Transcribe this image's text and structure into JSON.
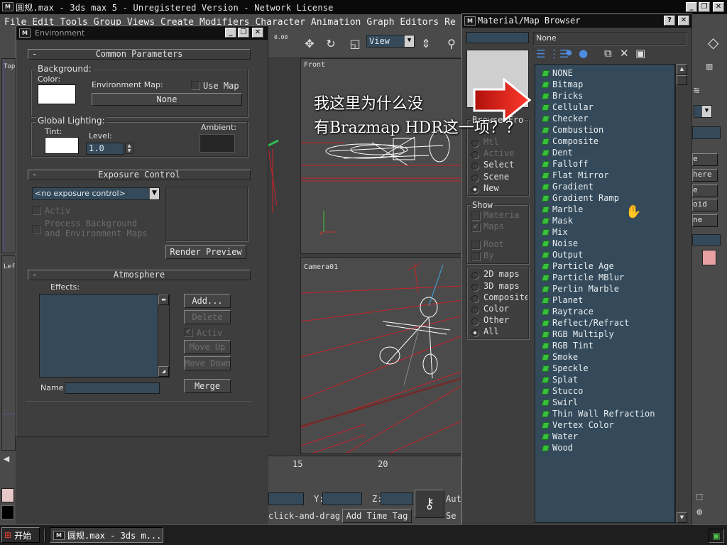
{
  "window": {
    "title": "圆规.max - 3ds max 5 - Unregistered Version - Network License",
    "app_icon": "3ds-max-icon",
    "controls": [
      "minimize",
      "restore",
      "close"
    ]
  },
  "menu": [
    "File",
    "Edit",
    "Tools",
    "Group",
    "Views",
    "Create",
    "Modifiers",
    "Character",
    "Animation",
    "Graph Editors",
    "Re"
  ],
  "toolbar": {
    "view_label": "View",
    "counter": "0.00"
  },
  "viewports": {
    "top_label": "Top",
    "left_label": "Left",
    "front_label": "Front",
    "camera_label": "Camera01"
  },
  "timeline": {
    "ticks": [
      "15",
      "20"
    ],
    "coord_y_label": "Y:",
    "coord_z_label": "Z:",
    "prompt": "click-and-drag",
    "add_time_tag": "Add Time Tag",
    "auto_label": "Aut",
    "set_label": "Se"
  },
  "environment": {
    "title": "Environment",
    "common_params": {
      "header": "Common Parameters",
      "background_group": "Background:",
      "color_label": "Color:",
      "color_value": "#ffffff",
      "env_map_label": "Environment Map:",
      "use_map_label": "Use Map",
      "use_map_checked": false,
      "env_map_button": "None",
      "global_lighting_group": "Global Lighting:",
      "tint_label": "Tint:",
      "tint_value": "#ffffff",
      "level_label": "Level:",
      "level_value": "1.0",
      "ambient_label": "Ambient:",
      "ambient_value": "#262626"
    },
    "exposure": {
      "header": "Exposure Control",
      "dropdown_value": "<no exposure control>",
      "active_label": "Activ",
      "process_bg_line1": "Process Background",
      "process_bg_line2": "and Environment Maps",
      "render_preview": "Render Preview"
    },
    "atmosphere": {
      "header": "Atmosphere",
      "effects_label": "Effects:",
      "add": "Add...",
      "delete": "Delete",
      "active": "Activ",
      "move_up": "Move Up",
      "move_down": "Move Down",
      "name_label": "Name:",
      "name_value": "",
      "merge": "Merge"
    }
  },
  "material_browser": {
    "title": "Material/Map Browser",
    "name_field": "",
    "selected_name": "None",
    "browse_from": {
      "label": "Browse Fro",
      "options": [
        "Mtl",
        "Active",
        "Select",
        "Scene",
        "New"
      ],
      "selected": "New"
    },
    "show": {
      "label": "Show",
      "materials": "Materia",
      "maps": "Maps",
      "maps_checked": true,
      "root": "Root",
      "by": "By"
    },
    "map_filter": {
      "options": [
        "2D maps",
        "3D maps",
        "Composite",
        "Color",
        "Other",
        "All"
      ],
      "selected": "All"
    },
    "maps": [
      "NONE",
      "Bitmap",
      "Bricks",
      "Cellular",
      "Checker",
      "Combustion",
      "Composite",
      "Dent",
      "Falloff",
      "Flat Mirror",
      "Gradient",
      "Gradient Ramp",
      "Marble",
      "Mask",
      "Mix",
      "Noise",
      "Output",
      "Particle Age",
      "Particle MBlur",
      "Perlin Marble",
      "Planet",
      "Raytrace",
      "Reflect/Refract",
      "RGB Multiply",
      "RGB Tint",
      "Smoke",
      "Speckle",
      "Splat",
      "Stucco",
      "Swirl",
      "Thin Wall Refraction",
      "Vertex Color",
      "Water",
      "Wood"
    ]
  },
  "annotation": {
    "line1": "我这里为什么没",
    "line2": "有Brazmap HDR这一项？？",
    "arrow_color": "#e8231a"
  },
  "command_panel": {
    "items": [
      "e",
      "here",
      "e",
      "oid",
      "ne"
    ],
    "swatch_color": "#e8a0a0"
  },
  "taskbar": {
    "start_label": "开始",
    "task_label": "圆规.max - 3ds m..."
  },
  "colors": {
    "dialog_bg": "#3e3e3e",
    "field_bg": "#344a5a",
    "map_icon": "#39c13d"
  }
}
